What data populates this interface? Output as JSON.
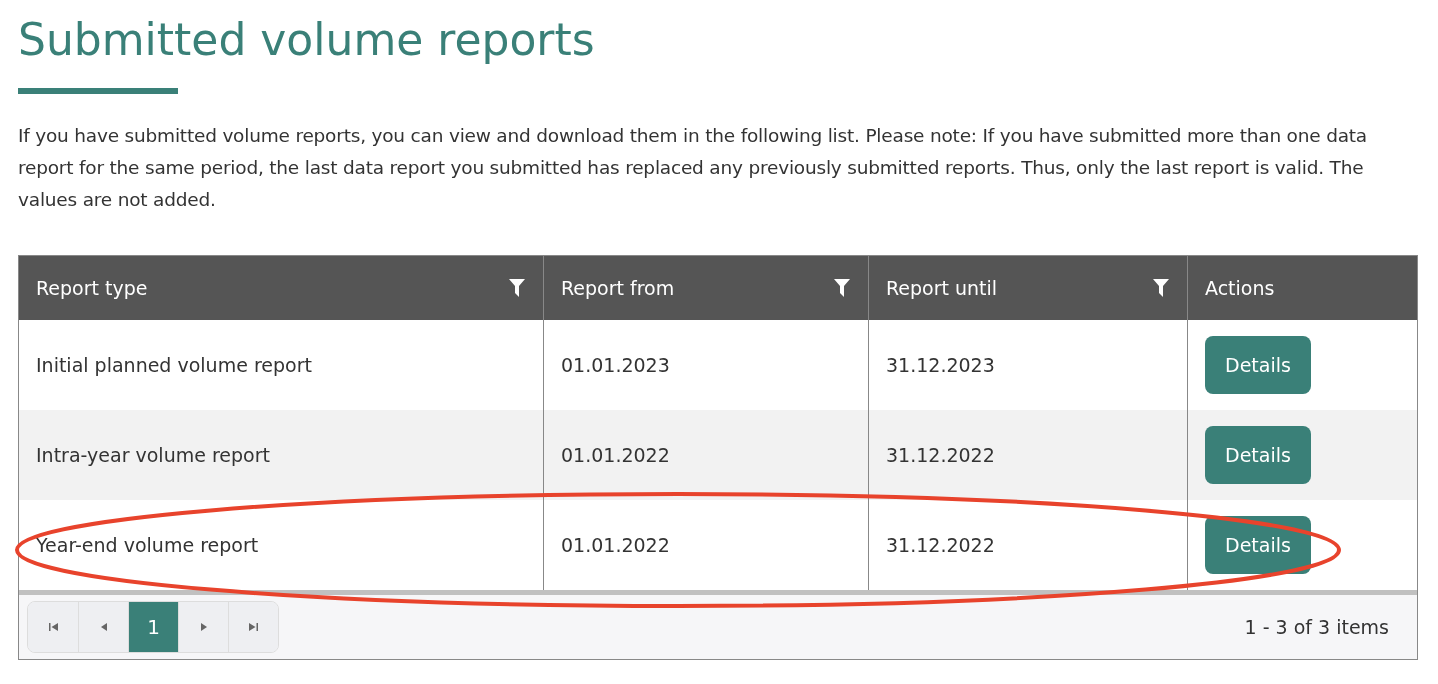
{
  "title": "Submitted volume reports",
  "intro": "If you have submitted volume reports, you can view and download them in the following list. Please note: If you have submitted more than one data report for the same period, the last data report you submitted has replaced any previously submitted reports. Thus, only the last report is valid. The values are not added.",
  "table": {
    "columns": [
      {
        "label": "Report type",
        "filter": true
      },
      {
        "label": "Report from",
        "filter": true
      },
      {
        "label": "Report until",
        "filter": true
      },
      {
        "label": "Actions",
        "filter": false
      }
    ],
    "rows": [
      {
        "type": "Initial planned volume report",
        "from": "01.01.2023",
        "until": "31.12.2023",
        "action": "Details",
        "highlighted": false
      },
      {
        "type": "Intra-year volume report",
        "from": "01.01.2022",
        "until": "31.12.2022",
        "action": "Details",
        "highlighted": false
      },
      {
        "type": "Year-end volume report",
        "from": "01.01.2022",
        "until": "31.12.2022",
        "action": "Details",
        "highlighted": true
      }
    ]
  },
  "pager": {
    "pages": [
      {
        "label": "1",
        "selected": true
      }
    ],
    "summary": "1 - 3 of 3 items"
  }
}
